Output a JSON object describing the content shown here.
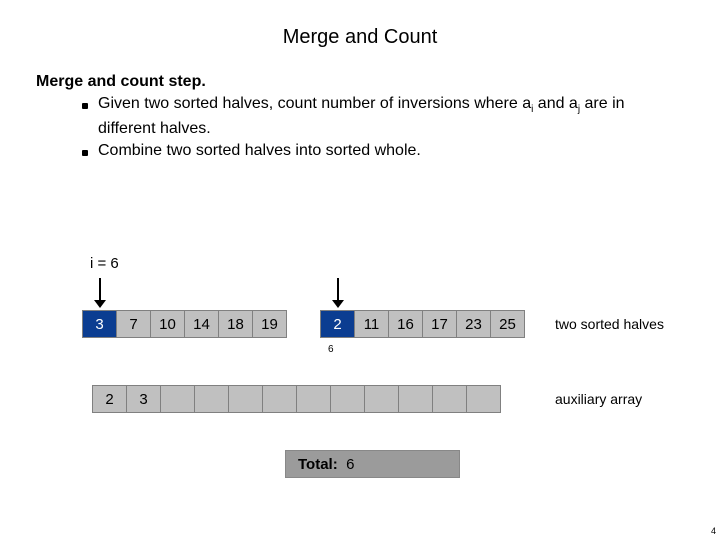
{
  "title": "Merge and Count",
  "heading": "Merge and count step.",
  "bullets": [
    {
      "pre": "Given two sorted halves, count number of inversions where a",
      "sub1": "i",
      "mid": " and a",
      "sub2": "j",
      "post": " are in different halves."
    },
    {
      "text": "Combine two sorted halves into sorted whole."
    }
  ],
  "ilabel": "i = 6",
  "halves": {
    "left": [
      "3",
      "7",
      "10",
      "14",
      "18",
      "19"
    ],
    "right": [
      "2",
      "11",
      "16",
      "17",
      "23",
      "25"
    ],
    "hl_left_index": 0,
    "hl_right_index": 0,
    "label": "two sorted halves"
  },
  "smallnum": "6",
  "aux": {
    "cells": [
      "2",
      "3",
      "",
      "",
      "",
      "",
      "",
      "",
      "",
      "",
      "",
      ""
    ],
    "label": "auxiliary array"
  },
  "total": {
    "label": "Total:",
    "value": "6"
  },
  "pagenum": "4"
}
